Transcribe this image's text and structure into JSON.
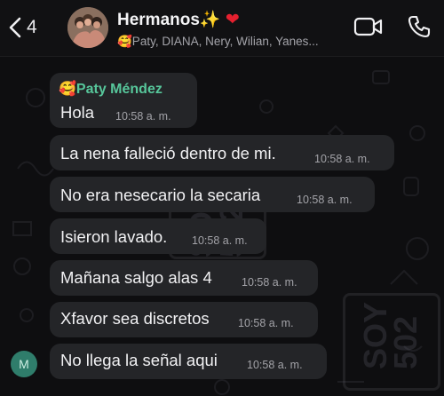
{
  "header": {
    "back_count": "4",
    "title": "Hermanos",
    "title_decoration": "✨",
    "title_heart": "❤",
    "members": "🥰Paty, DIANA, Nery, Wilian, Yanes..."
  },
  "messages": [
    {
      "sender": "🥰Paty Méndez",
      "text": "Hola",
      "time": "10:58 a. m."
    },
    {
      "text": "La nena falleció dentro de mi.",
      "time": "10:58 a. m."
    },
    {
      "text": "No era nesecario la secaria",
      "time": "10:58 a. m."
    },
    {
      "text": "Isieron lavado.",
      "time": "10:58 a. m."
    },
    {
      "text": "Mañana salgo alas 4",
      "time": "10:58 a. m."
    },
    {
      "text": "Xfavor sea discretos",
      "time": "10:58 a. m."
    },
    {
      "text": "No llega la señal aqui",
      "time": "10:58 a. m."
    }
  ],
  "sender_avatar_letter": "M",
  "watermark": "SOY 502",
  "icons": [
    "chevron-left-icon",
    "video-camera-icon",
    "phone-icon"
  ],
  "colors": {
    "sender_name": "#57c79b",
    "bubble": "#242528",
    "background": "#0e0e10"
  }
}
